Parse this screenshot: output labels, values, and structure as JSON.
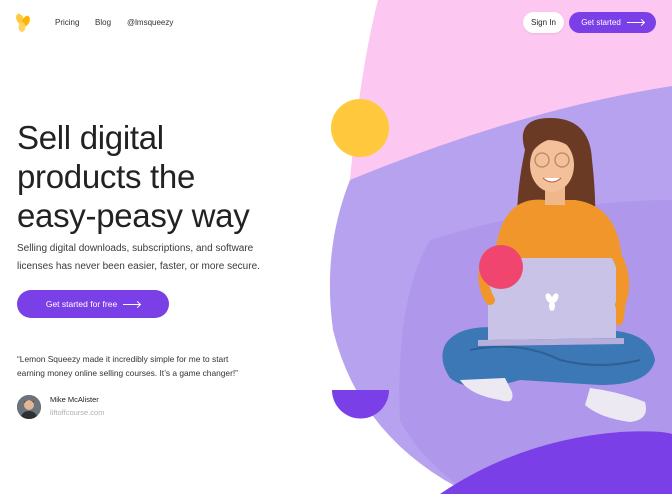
{
  "nav": {
    "links": [
      "Pricing",
      "Blog",
      "@lmsqueezy"
    ],
    "signin_label": "Sign In",
    "cta_label": "Get started"
  },
  "hero": {
    "title_lines": [
      "Sell digital",
      "products the",
      "easy-peasy way"
    ],
    "subtitle_lines": [
      "Selling digital downloads, subscriptions, and software",
      "licenses has never been easier, faster, or more secure."
    ],
    "cta_label": "Get started for free"
  },
  "testimonial": {
    "quote_lines": [
      "“Lemon Squeezy made it incredibly simple for me to start",
      "earning money online selling courses. It’s a game changer!”"
    ],
    "author_name": "Mike McAlister",
    "author_site": "liftoffcourse.com"
  },
  "colors": {
    "brand_purple": "#7b3fe8",
    "pink_bg": "#fbc8f0",
    "lavender_bg": "#b7a6f0",
    "yellow_circle": "#ffc83d",
    "pink_circle": "#f0456f"
  },
  "icons": {
    "logo": "lemon-squeezy-logo-icon",
    "arrow": "arrow-right-icon"
  }
}
